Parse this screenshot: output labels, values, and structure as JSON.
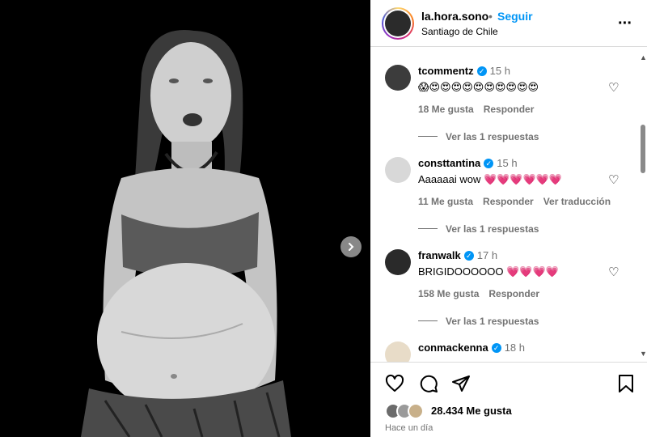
{
  "header": {
    "username": "la.hora.sono",
    "separator": "•",
    "follow_label": "Seguir",
    "location": "Santiago de Chile",
    "more_icon": "more-horizontal-icon"
  },
  "comments": [
    {
      "user": "tcommentz",
      "verified": true,
      "time": "15 h",
      "text": "😱😍😍😍😍😍😍😍😍😍😍",
      "likes": "18 Me gusta",
      "reply": "Responder",
      "translate": "",
      "replies": "Ver las 1 respuestas"
    },
    {
      "user": "consttantina",
      "verified": true,
      "time": "15 h",
      "text": "Aaaaaai wow 💗💗💗💗💗💗",
      "likes": "11 Me gusta",
      "reply": "Responder",
      "translate": "Ver traducción",
      "replies": "Ver las 1 respuestas"
    },
    {
      "user": "franwalk",
      "verified": true,
      "time": "17 h",
      "text": "BRIGIDOOOOOO 💗💗💗💗",
      "likes": "158 Me gusta",
      "reply": "Responder",
      "translate": "",
      "replies": "Ver las 1 respuestas"
    },
    {
      "user": "conmackenna",
      "verified": true,
      "time": "18 h",
      "text": "",
      "likes": "",
      "reply": "",
      "translate": "",
      "replies": ""
    }
  ],
  "footer": {
    "likes": "28.434 Me gusta",
    "time_ago": "Hace un día"
  },
  "colors": {
    "accent": "#0095f6",
    "muted": "#737373",
    "border": "#dbdbdb"
  }
}
